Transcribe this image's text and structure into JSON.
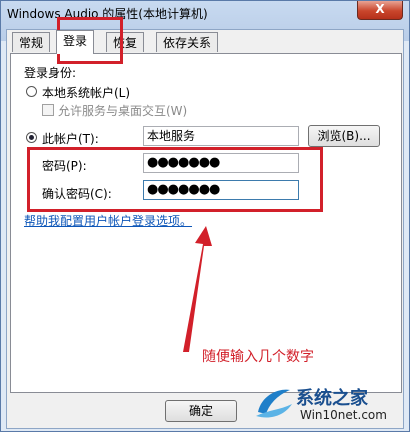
{
  "window": {
    "title": "Windows Audio 的属性(本地计算机)",
    "close_label": "X"
  },
  "tabs": [
    {
      "label": "常规"
    },
    {
      "label": "登录"
    },
    {
      "label": "恢复"
    },
    {
      "label": "依存关系"
    }
  ],
  "logon": {
    "section_label": "登录身份:",
    "local_system_label": "本地系统帐户(L)",
    "allow_desktop_label": "允许服务与桌面交互(W)",
    "this_account_label": "此帐户(T):",
    "account_value": "本地服务",
    "browse_label": "浏览(B)...",
    "password_label": "密码(P):",
    "password_value": "●●●●●●●",
    "confirm_label": "确认密码(C):",
    "confirm_value": "●●●●●●●",
    "help_link": "帮助我配置用户帐户登录选项。"
  },
  "footer": {
    "ok_label": "确定"
  },
  "annotation": {
    "text": "随便输入几个数字",
    "color": "#d2202a"
  },
  "watermark": {
    "name": "系统之家",
    "url": "Win10net.com"
  }
}
